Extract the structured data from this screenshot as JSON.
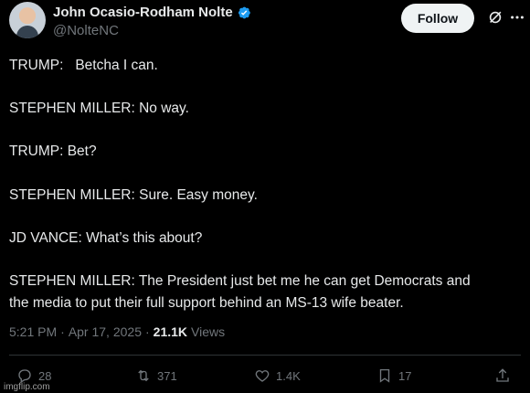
{
  "author": {
    "name": "John Ocasio-Rodham Nolte",
    "handle": "@NolteNC",
    "avatar_icon": "avatar"
  },
  "header": {
    "follow_label": "Follow",
    "grok_icon": "grok-icon",
    "more_icon": "more-icon"
  },
  "tweet": {
    "lines": [
      "TRUMP:   Betcha I can.",
      "",
      "STEPHEN MILLER: No way.",
      "",
      "TRUMP: Bet?",
      "",
      "STEPHEN MILLER: Sure. Easy money.",
      "",
      "JD VANCE: What’s this about?",
      "",
      "STEPHEN MILLER: The President just bet me he can get Democrats and",
      "the media to put their full support behind an MS-13 wife beater."
    ]
  },
  "meta": {
    "time": "5:21 PM",
    "dot1": "·",
    "date": "Apr 17, 2025",
    "dot2": "·",
    "views_count": "21.1K",
    "views_label": "Views"
  },
  "actions": {
    "replies": "28",
    "reposts": "371",
    "likes": "1.4K",
    "bookmarks": "17"
  },
  "watermark": "imgflip.com",
  "colors": {
    "background": "#000000",
    "text": "#e7e9ea",
    "muted": "#71767b",
    "verified": "#1d9bf0",
    "follow_bg": "#eff3f4"
  }
}
